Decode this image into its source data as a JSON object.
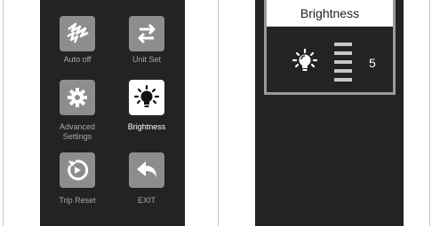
{
  "menu": {
    "items": [
      {
        "label": "Auto off",
        "icon": "auto-off-icon"
      },
      {
        "label": "Unit Set",
        "icon": "unit-set-icon"
      },
      {
        "label": "Advanced\nSettings",
        "icon": "gear-icon"
      },
      {
        "label": "Brightness",
        "icon": "bulb-icon",
        "selected": true
      },
      {
        "label": "Trip Reset",
        "icon": "trip-reset-icon"
      },
      {
        "label": "EXIT",
        "icon": "back-arrow-icon"
      }
    ]
  },
  "brightness_panel": {
    "title": "Brightness",
    "level": "5"
  },
  "colors": {
    "panel_bg": "#232323",
    "icon_bg": "#8d8d8d",
    "selected_bg": "#ffffff",
    "label_color": "#a9a9a9"
  }
}
